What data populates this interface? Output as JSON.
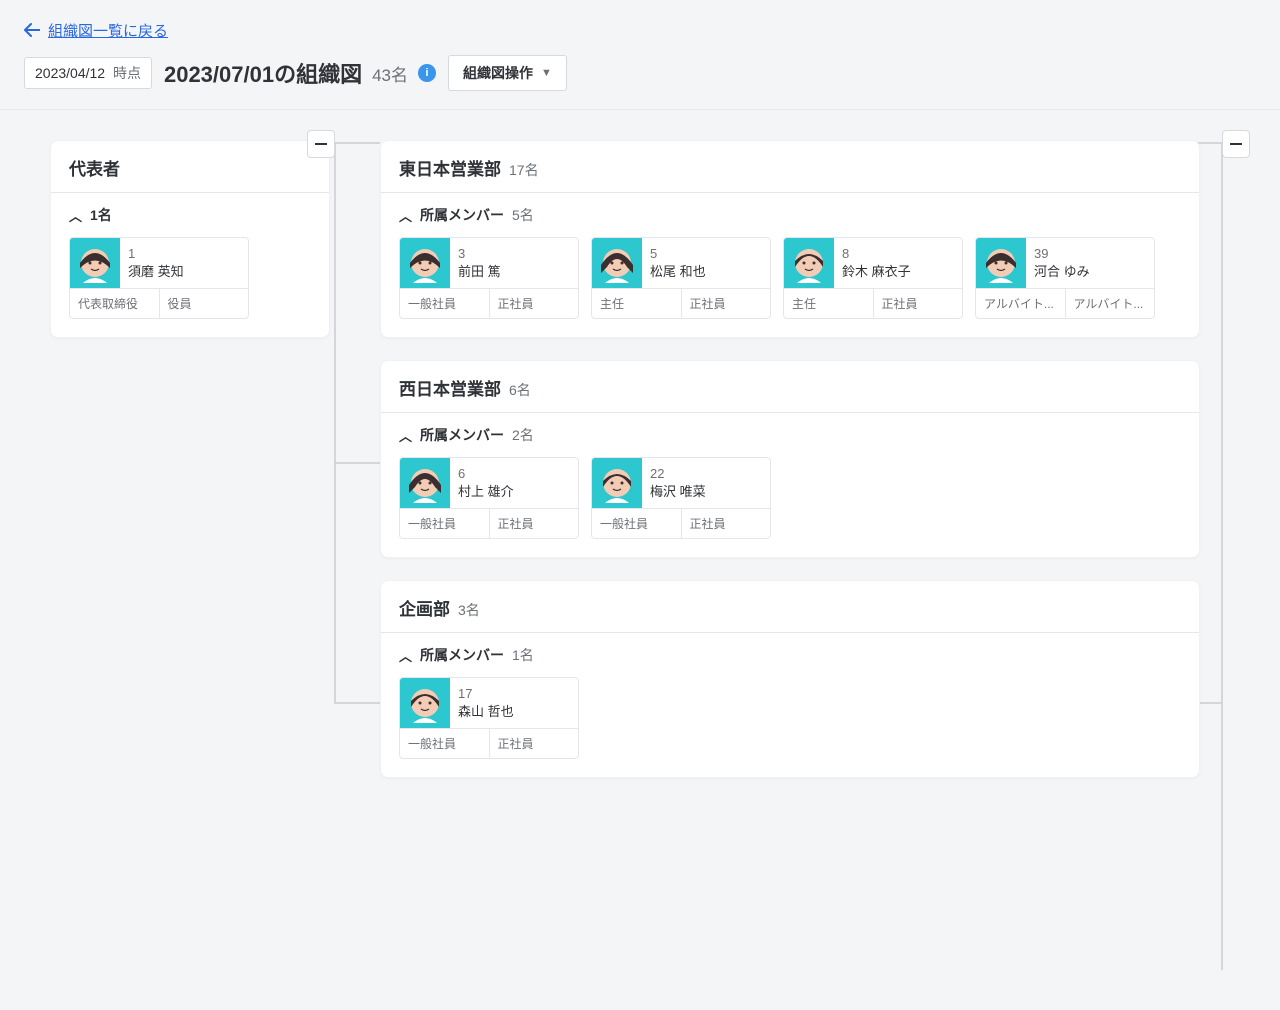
{
  "back_link": "組織図一覧に戻る",
  "as_of_date": "2023/04/12",
  "as_of_suffix": "時点",
  "chart_title": "2023/07/01の組織図",
  "total_count": "43名",
  "menu_label": "組織図操作",
  "members_label": "所属メンバー",
  "root": {
    "title": "代表者",
    "member_count": "1名",
    "members": [
      {
        "id": "1",
        "name": "須磨 英知",
        "role1": "代表取締役",
        "role2": "役員"
      }
    ]
  },
  "departments": [
    {
      "title": "東日本営業部",
      "dept_count": "17名",
      "member_count": "5名",
      "members": [
        {
          "id": "3",
          "name": "前田 篤",
          "role1": "一般社員",
          "role2": "正社員"
        },
        {
          "id": "5",
          "name": "松尾 和也",
          "role1": "主任",
          "role2": "正社員"
        },
        {
          "id": "8",
          "name": "鈴木 麻衣子",
          "role1": "主任",
          "role2": "正社員"
        },
        {
          "id": "39",
          "name": "河合 ゆみ",
          "role1": "アルバイト...",
          "role2": "アルバイト..."
        }
      ]
    },
    {
      "title": "西日本営業部",
      "dept_count": "6名",
      "member_count": "2名",
      "members": [
        {
          "id": "6",
          "name": "村上 雄介",
          "role1": "一般社員",
          "role2": "正社員"
        },
        {
          "id": "22",
          "name": "梅沢 唯菜",
          "role1": "一般社員",
          "role2": "正社員"
        }
      ]
    },
    {
      "title": "企画部",
      "dept_count": "3名",
      "member_count": "1名",
      "members": [
        {
          "id": "17",
          "name": "森山 哲也",
          "role1": "一般社員",
          "role2": "正社員"
        }
      ]
    }
  ]
}
